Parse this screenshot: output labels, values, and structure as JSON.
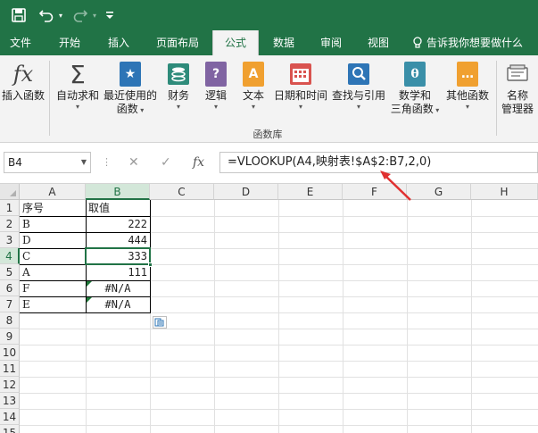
{
  "title_bar": {
    "save_icon": "save-icon",
    "undo_icon": "undo-icon",
    "redo_icon": "redo-icon",
    "customize_icon": "customize-icon"
  },
  "tabs": [
    {
      "label": "文件"
    },
    {
      "label": "开始"
    },
    {
      "label": "插入"
    },
    {
      "label": "页面布局"
    },
    {
      "label": "公式",
      "active": true
    },
    {
      "label": "数据"
    },
    {
      "label": "审阅"
    },
    {
      "label": "视图"
    }
  ],
  "tell_me": "告诉我你想要做什么",
  "ribbon": {
    "buttons": [
      {
        "line1": "插入函数",
        "line2": "",
        "icon": "fx-icon"
      },
      {
        "line1": "自动求和",
        "line2": "",
        "icon": "sigma-icon"
      },
      {
        "line1": "最近使用的",
        "line2": "函数",
        "icon": "recent-star-icon"
      },
      {
        "line1": "财务",
        "line2": "",
        "icon": "financial-icon"
      },
      {
        "line1": "逻辑",
        "line2": "",
        "icon": "logical-icon"
      },
      {
        "line1": "文本",
        "line2": "",
        "icon": "text-icon"
      },
      {
        "line1": "日期和时间",
        "line2": "",
        "icon": "calendar-icon"
      },
      {
        "line1": "查找与引用",
        "line2": "",
        "icon": "lookup-icon"
      },
      {
        "line1": "数学和",
        "line2": "三角函数",
        "icon": "theta-icon"
      },
      {
        "line1": "其他函数",
        "line2": "",
        "icon": "more-functions-icon"
      },
      {
        "line1": "名称",
        "line2": "管理器",
        "icon": "name-manager-icon"
      }
    ],
    "group_label": "函数库",
    "colors": {
      "blue": "#2e75b6",
      "purple": "#8064a2",
      "orange": "#f0a030",
      "red": "#d9534f",
      "teal": "#3a8fa8",
      "green": "#217346"
    }
  },
  "formula_bar": {
    "name_box": "B4",
    "cancel": "✕",
    "enter": "✓",
    "fx": "fx",
    "formula": "=VLOOKUP(A4,映射表!$A$2:B7,2,0)"
  },
  "sheet": {
    "columns": [
      "A",
      "B",
      "C",
      "D",
      "E",
      "F",
      "G",
      "H"
    ],
    "rows": [
      "1",
      "2",
      "3",
      "4",
      "5",
      "6",
      "7",
      "8",
      "9",
      "10",
      "11",
      "12",
      "13",
      "14",
      "15"
    ],
    "selected_cell": "B4",
    "data": [
      {
        "a": "序号",
        "b": "取值"
      },
      {
        "a": "B",
        "b": "222"
      },
      {
        "a": "D",
        "b": "444"
      },
      {
        "a": "C",
        "b": "333"
      },
      {
        "a": "A",
        "b": "111"
      },
      {
        "a": "F",
        "b": "#N/A"
      },
      {
        "a": "E",
        "b": "#N/A"
      }
    ],
    "accent_color": "#217346",
    "error_marker_color": "#1f7a3a",
    "arrow_color": "#e03030"
  }
}
